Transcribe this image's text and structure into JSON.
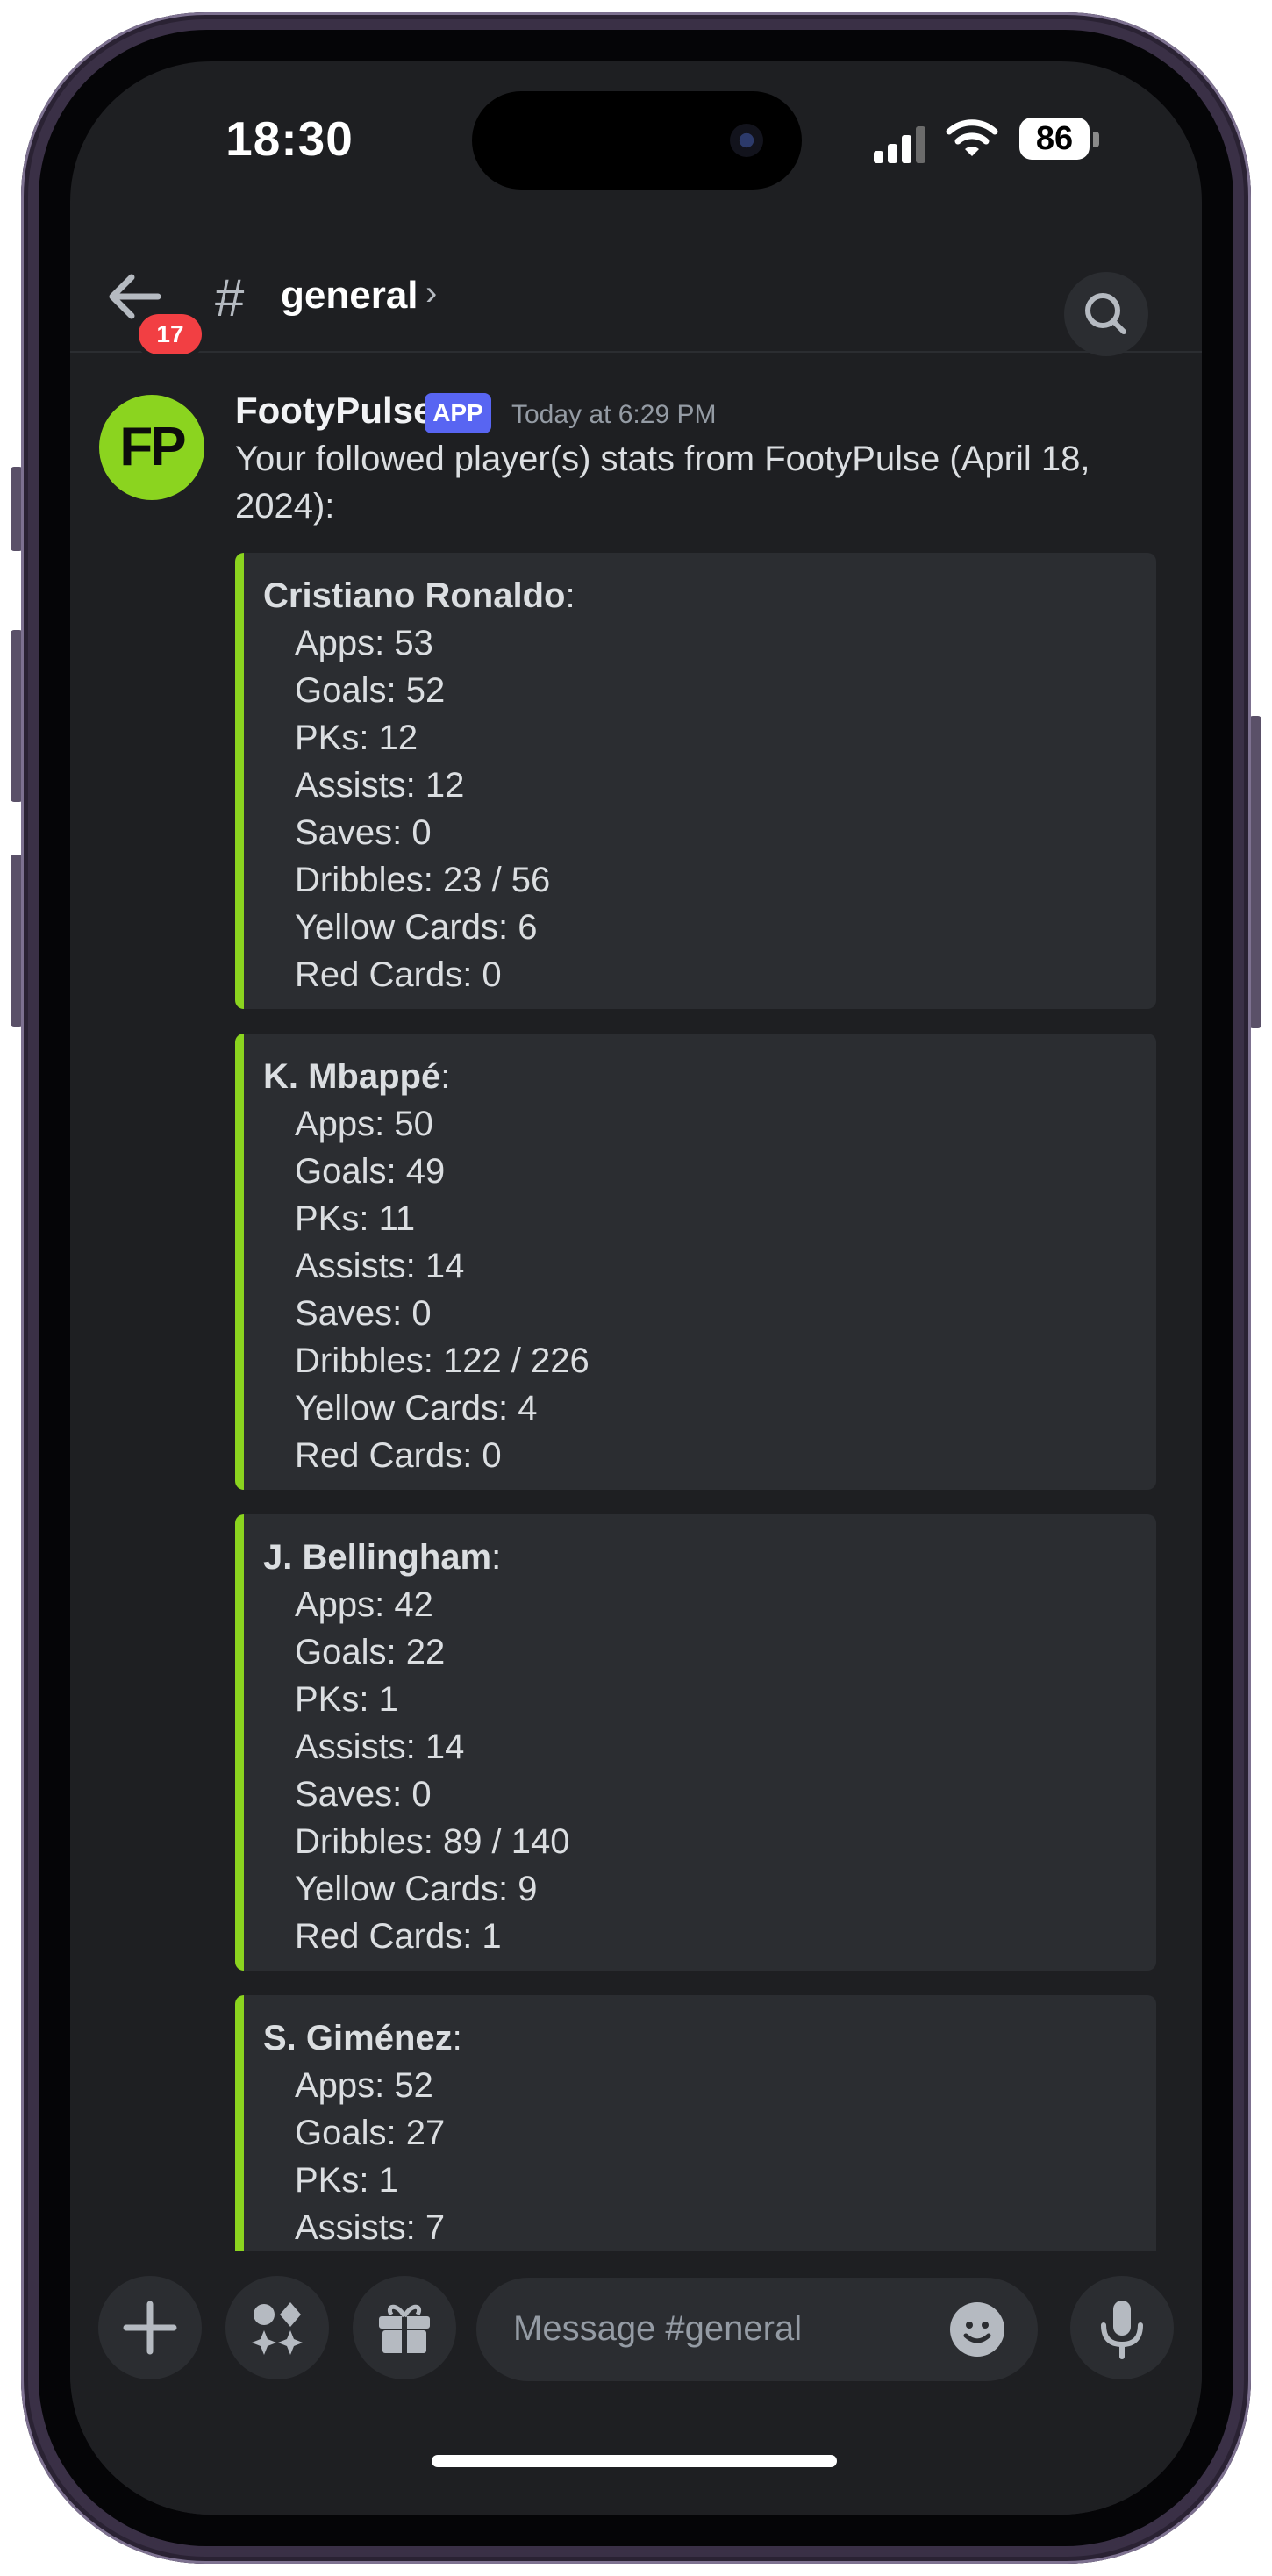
{
  "status_bar": {
    "time": "18:30",
    "battery": "86"
  },
  "header": {
    "back_badge": "17",
    "channel_symbol": "#",
    "channel_name": "general",
    "chevron": "›"
  },
  "message": {
    "avatar_text": "FP",
    "author": "FootyPulse",
    "tag": "APP",
    "timestamp": "Today at 6:29 PM",
    "text": "Your followed player(s) stats from FootyPulse (April 18, 2024):",
    "accent_color": "#8bd41f"
  },
  "players": [
    {
      "name": "Cristiano Ronaldo",
      "stats": [
        "Apps: 53",
        "Goals: 52",
        "PKs: 12",
        "Assists: 12",
        "Saves: 0",
        "Dribbles: 23 / 56",
        "Yellow Cards: 6",
        "Red Cards: 0"
      ]
    },
    {
      "name": "K. Mbappé",
      "stats": [
        "Apps: 50",
        "Goals: 49",
        "PKs: 11",
        "Assists: 14",
        "Saves: 0",
        "Dribbles: 122 / 226",
        "Yellow Cards: 4",
        "Red Cards: 0"
      ]
    },
    {
      "name": "J. Bellingham",
      "stats": [
        "Apps: 42",
        "Goals: 22",
        "PKs: 1",
        "Assists: 14",
        "Saves: 0",
        "Dribbles: 89 / 140",
        "Yellow Cards: 9",
        "Red Cards: 1"
      ]
    },
    {
      "name": "S. Giménez",
      "stats": [
        "Apps: 52",
        "Goals: 27",
        "PKs: 1",
        "Assists: 7"
      ]
    }
  ],
  "composer": {
    "placeholder": "Message #general",
    "icons": [
      "plus-icon",
      "apps-icon",
      "gift-icon",
      "emoji-icon",
      "microphone-icon"
    ]
  },
  "colors": {
    "background": "#1e1f22",
    "embed_background": "#2b2d31",
    "badge": "#f23f43",
    "app_tag": "#5865f2"
  }
}
